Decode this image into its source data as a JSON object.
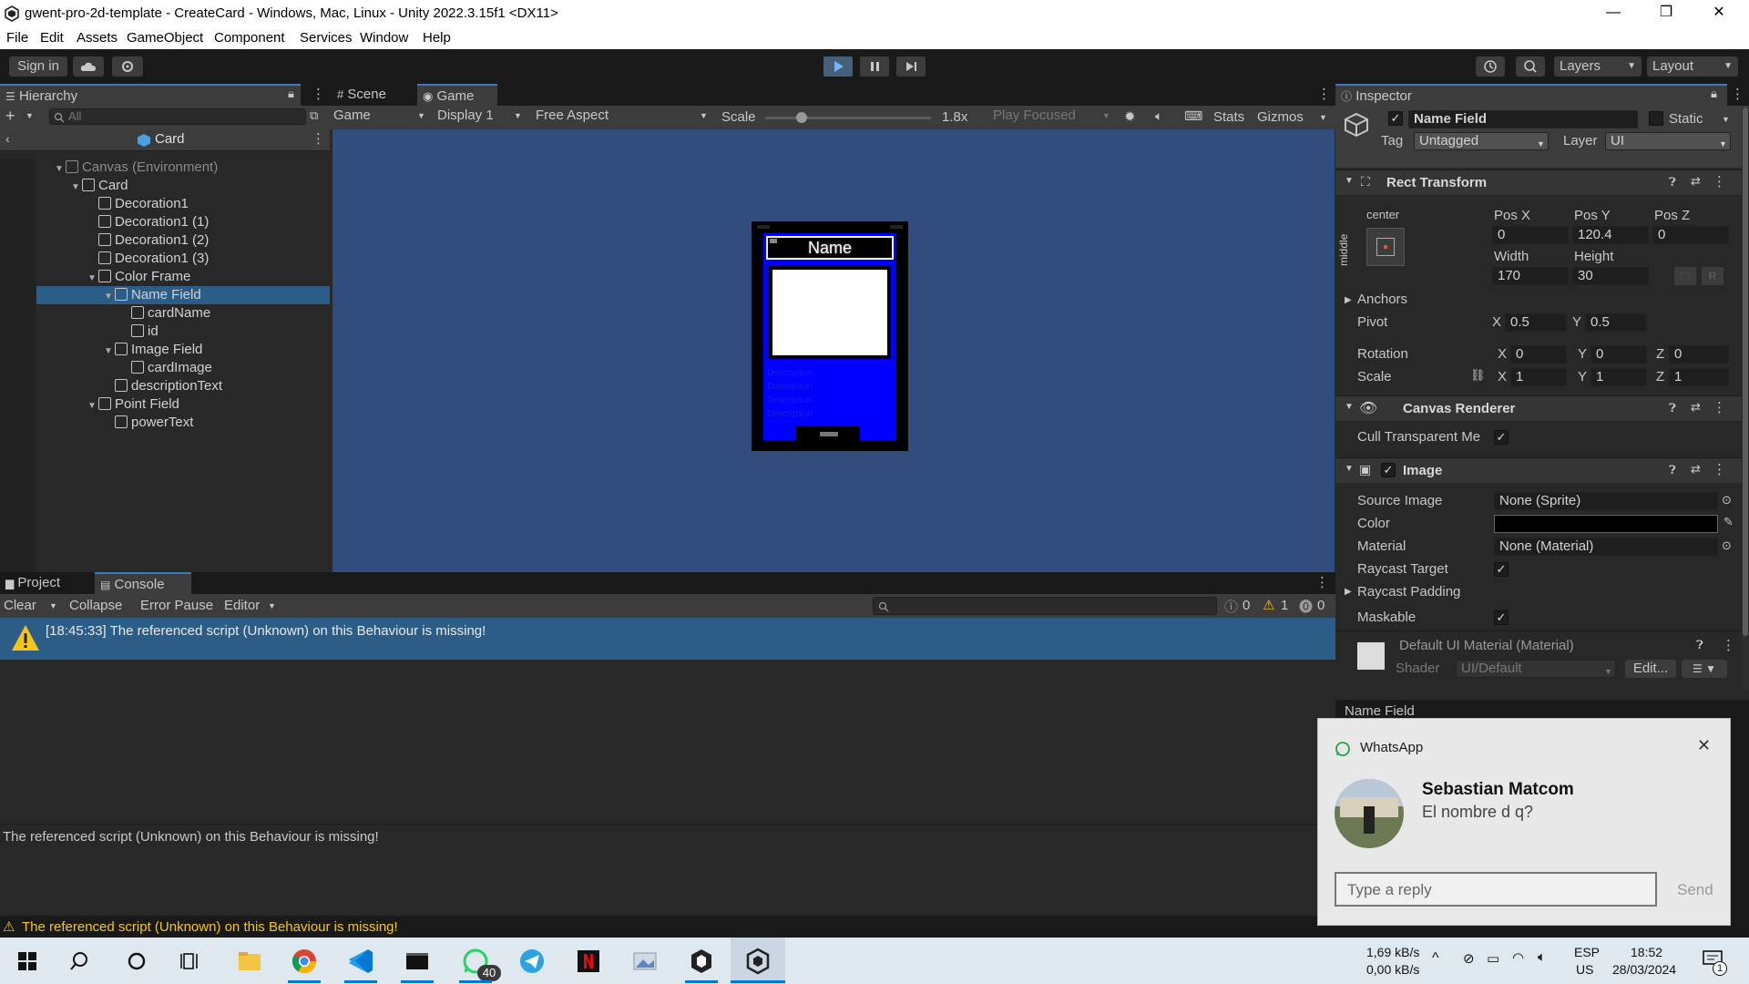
{
  "window": {
    "title": "gwent-pro-2d-template - CreateCard - Windows, Mac, Linux - Unity 2022.3.15f1 <DX11>",
    "minimize": "—",
    "maximize": "❐",
    "close": "✕"
  },
  "menu": [
    "File",
    "Edit",
    "Assets",
    "GameObject",
    "Component",
    "Services",
    "Window",
    "Help"
  ],
  "toolbar": {
    "sign_in": "Sign in",
    "layers": "Layers",
    "layout": "Layout"
  },
  "hierarchy": {
    "tab": "Hierarchy",
    "search_placeholder": "All",
    "scene_title": "Card",
    "rows": [
      {
        "label": "Canvas (Environment)",
        "depth": 0,
        "expanded": true,
        "dim": true
      },
      {
        "label": "Card",
        "depth": 1,
        "expanded": true
      },
      {
        "label": "Decoration1",
        "depth": 2
      },
      {
        "label": "Decoration1 (1)",
        "depth": 2
      },
      {
        "label": "Decoration1 (2)",
        "depth": 2
      },
      {
        "label": "Decoration1 (3)",
        "depth": 2
      },
      {
        "label": "Color Frame",
        "depth": 2,
        "expanded": true
      },
      {
        "label": "Name Field",
        "depth": 3,
        "expanded": true,
        "selected": true
      },
      {
        "label": "cardName",
        "depth": 4
      },
      {
        "label": "id",
        "depth": 4
      },
      {
        "label": "Image Field",
        "depth": 3,
        "expanded": true
      },
      {
        "label": "cardImage",
        "depth": 4
      },
      {
        "label": "descriptionText",
        "depth": 3
      },
      {
        "label": "Point Field",
        "depth": 2,
        "expanded": true
      },
      {
        "label": "powerText",
        "depth": 3
      }
    ]
  },
  "game": {
    "tab_scene": "Scene",
    "tab_game": "Game",
    "mode": "Game",
    "display": "Display 1",
    "aspect": "Free Aspect",
    "scale_label": "Scale",
    "scale_value": "1.8x",
    "scale_fraction": 0.02,
    "play_focused": "Play Focused",
    "stats": "Stats",
    "gizmos": "Gizmos",
    "card_name": "Name",
    "card_desc_lines": [
      "Description",
      "Description",
      "Description",
      "Description"
    ]
  },
  "inspector": {
    "tab": "Inspector",
    "object_name": "Name Field",
    "static_label": "Static",
    "tag_label": "Tag",
    "tag_value": "Untagged",
    "layer_label": "Layer",
    "layer_value": "UI",
    "rect_transform": {
      "title": "Rect Transform",
      "anchor_h": "center",
      "anchor_v": "middle",
      "pos_x_label": "Pos X",
      "pos_x": "0",
      "pos_y_label": "Pos Y",
      "pos_y": "120.4",
      "pos_z_label": "Pos Z",
      "pos_z": "0",
      "width_label": "Width",
      "width": "170",
      "height_label": "Height",
      "height": "30",
      "r_button": "R",
      "anchors": "Anchors",
      "pivot": "Pivot",
      "pivot_x": "0.5",
      "pivot_y": "0.5",
      "rotation": "Rotation",
      "rot_x": "0",
      "rot_y": "0",
      "rot_z": "0",
      "scale": "Scale",
      "scale_x": "1",
      "scale_y": "1",
      "scale_z": "1",
      "x": "X",
      "y": "Y",
      "z": "Z"
    },
    "canvas_renderer": {
      "title": "Canvas Renderer",
      "cull_label": "Cull Transparent Me"
    },
    "image": {
      "title": "Image",
      "source_image_label": "Source Image",
      "source_image": "None (Sprite)",
      "color_label": "Color",
      "color": "#000000",
      "material_label": "Material",
      "material": "None (Material)",
      "raycast_target": "Raycast Target",
      "raycast_padding": "Raycast Padding",
      "maskable": "Maskable"
    },
    "material": {
      "title": "Default UI Material (Material)",
      "shader_label": "Shader",
      "shader": "UI/Default",
      "edit": "Edit..."
    },
    "footer": "Name Field"
  },
  "console": {
    "tab_project": "Project",
    "tab_console": "Console",
    "clear": "Clear",
    "collapse": "Collapse",
    "error_pause": "Error Pause",
    "editor": "Editor",
    "count_info": "0",
    "count_warn": "1",
    "count_error": "0",
    "entry": "[18:45:33] The referenced script (Unknown) on this Behaviour is missing!",
    "detail": "The referenced script (Unknown) on this Behaviour is missing!"
  },
  "status": {
    "message": "The referenced script (Unknown) on this Behaviour is missing!"
  },
  "toast": {
    "app": "WhatsApp",
    "sender": "Sebastian Matcom",
    "message": "El nombre d q?",
    "reply_placeholder": "Type a reply",
    "send": "Send"
  },
  "taskbar": {
    "whatsapp_badge": "40",
    "net_up": "1,69 kB/s",
    "net_down": "0,00 kB/s",
    "lang": "ESP",
    "region": "US",
    "time": "18:52",
    "date": "28/03/2024",
    "notif_count": "1"
  },
  "colors": {
    "accent": "#3a79bb",
    "selection": "#2c5d87",
    "game_bg": "#304d7d",
    "card_blue": "#0000ff",
    "warning": "#f5c518"
  }
}
